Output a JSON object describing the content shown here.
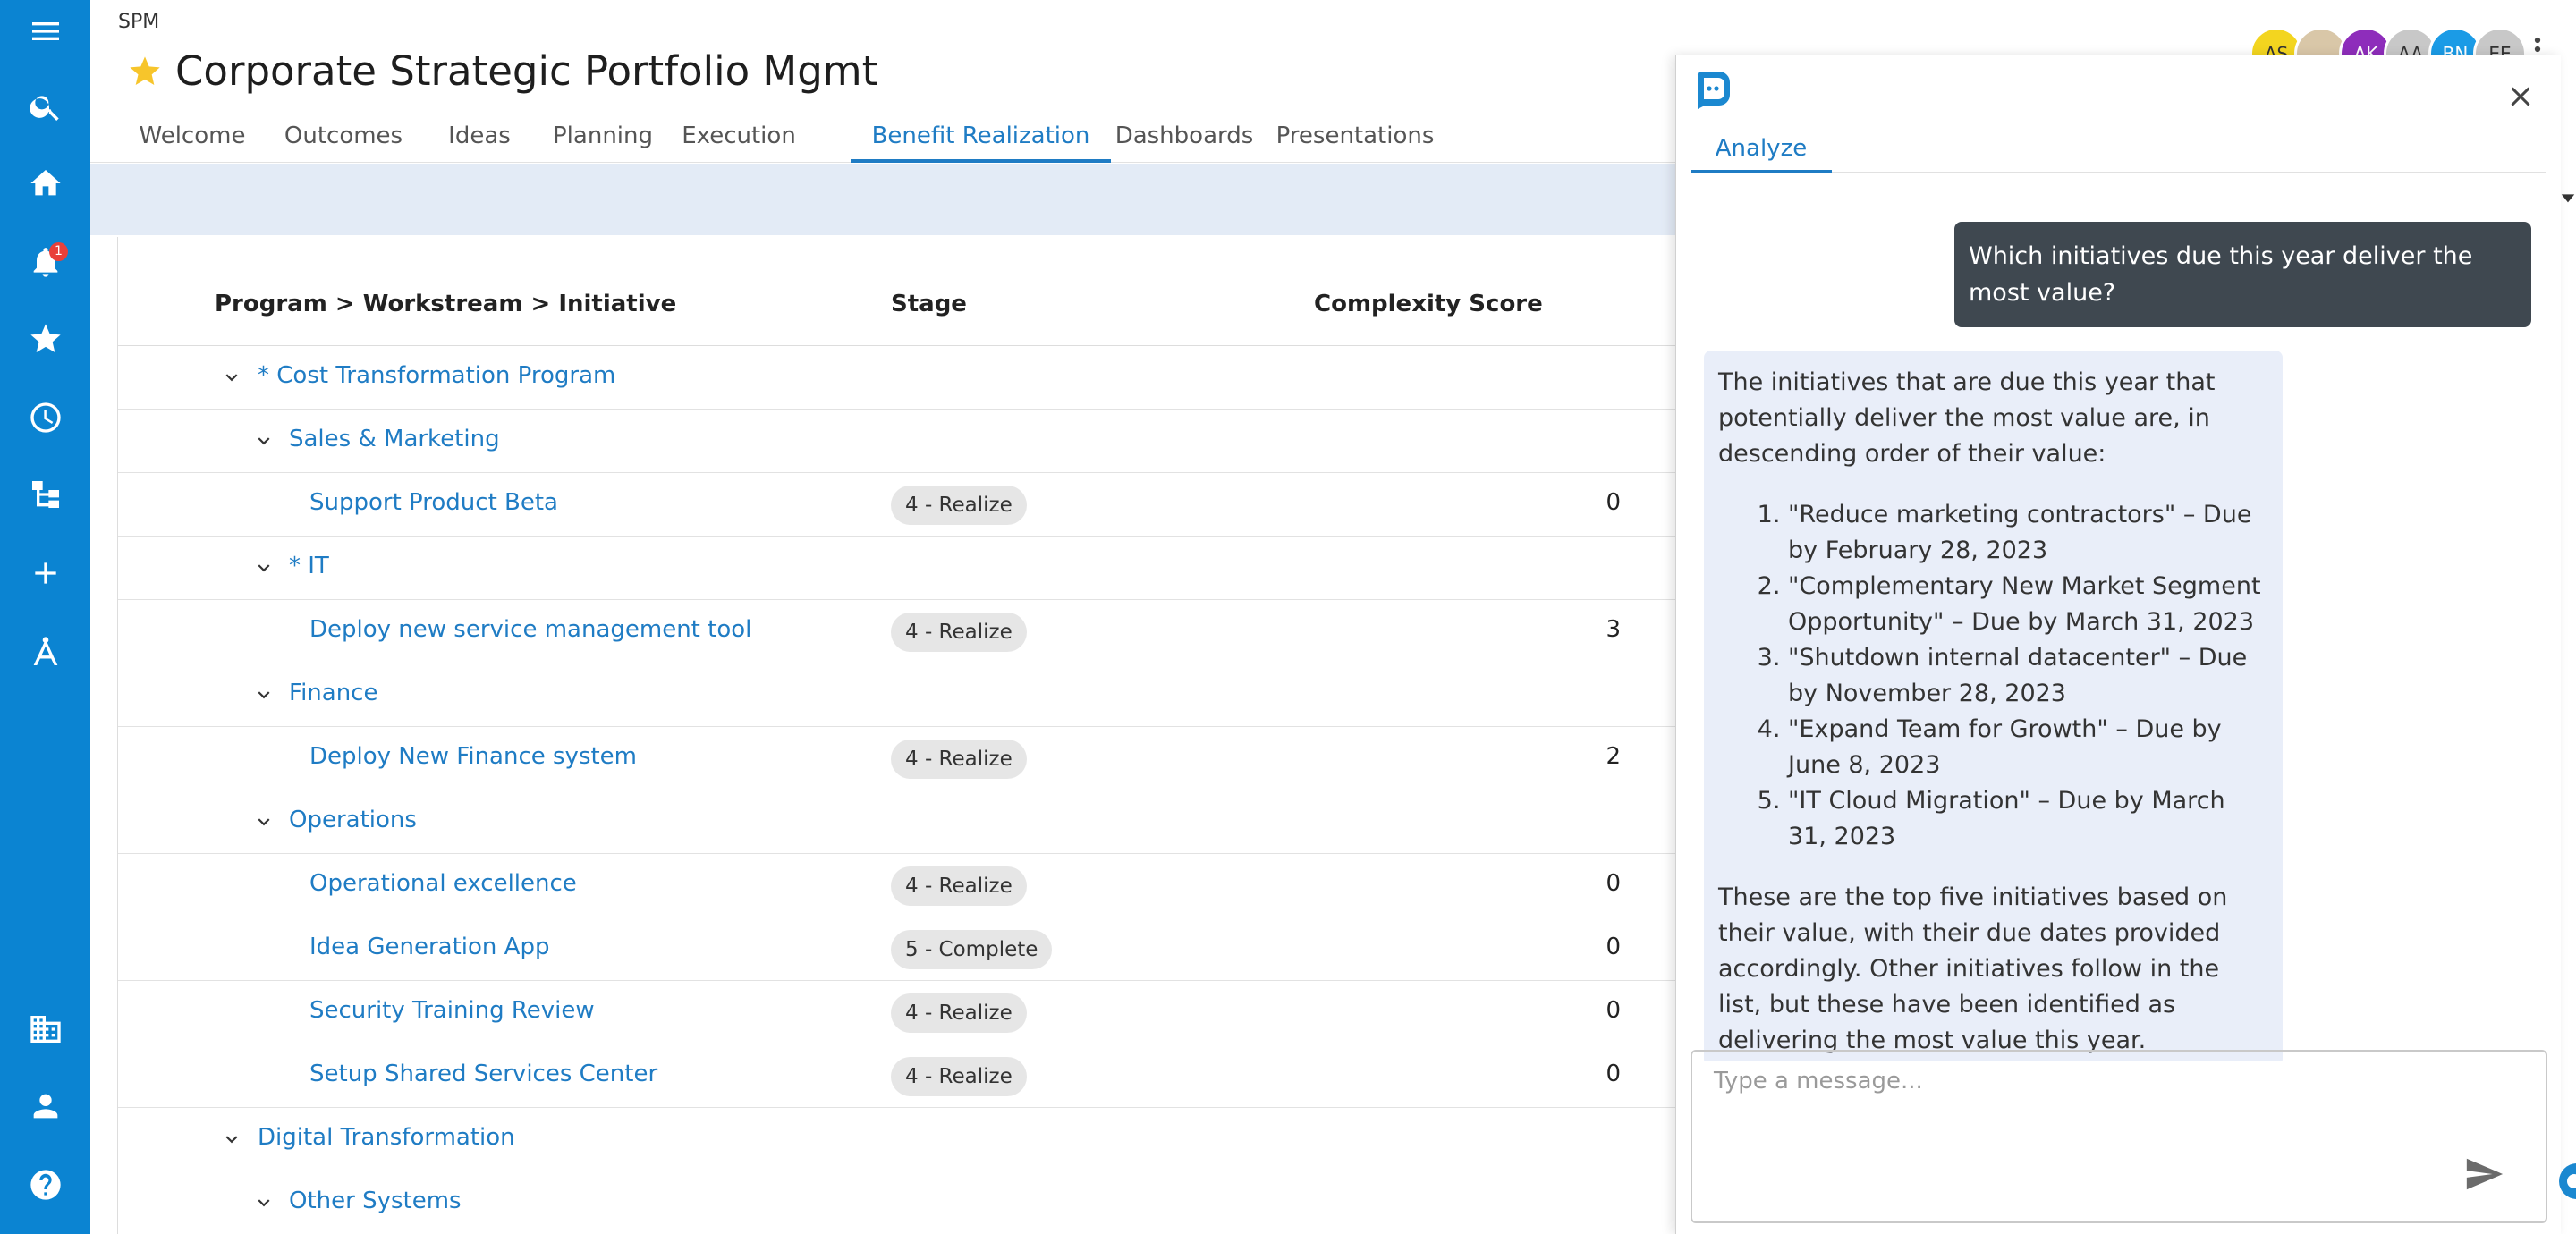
{
  "app": {
    "label": "SPM",
    "title": "Corporate Strategic Portfolio Mgmt"
  },
  "nav": {
    "notification_count": "1",
    "items": [
      "menu-icon",
      "search-icon",
      "home-icon",
      "bell-icon",
      "star-icon",
      "clock-icon",
      "hierarchy-icon",
      "plus-icon",
      "compass-icon",
      "building-icon",
      "user-icon",
      "help-icon"
    ]
  },
  "tabs": [
    "Welcome",
    "Outcomes",
    "Ideas",
    "Planning",
    "Execution",
    "Benefit Realization",
    "Dashboards",
    "Presentations"
  ],
  "active_tab": "Benefit Realization",
  "avatars": [
    {
      "initials": "AS",
      "color": "#f3d51f"
    },
    {
      "initials": "",
      "color": "#d9c7a8"
    },
    {
      "initials": "AK",
      "color": "#8e2dbb"
    },
    {
      "initials": "AA",
      "color": "#c8c8c8"
    },
    {
      "initials": "BN",
      "color": "#1b9be6"
    },
    {
      "initials": "EE",
      "color": "#c8c8c8"
    }
  ],
  "grid": {
    "headers": {
      "name": "Program > Workstream > Initiative",
      "stage": "Stage",
      "score": "Complexity Score"
    },
    "rows": [
      {
        "level": 0,
        "name": "* Cost Transformation Program",
        "stage": "",
        "score": ""
      },
      {
        "level": 1,
        "name": "Sales & Marketing",
        "stage": "",
        "score": ""
      },
      {
        "level": 2,
        "name": "Support Product Beta",
        "stage": "4 - Realize",
        "score": "0"
      },
      {
        "level": 1,
        "name": "* IT",
        "stage": "",
        "score": ""
      },
      {
        "level": 2,
        "name": "Deploy new service management tool",
        "stage": "4 - Realize",
        "score": "3"
      },
      {
        "level": 1,
        "name": "Finance",
        "stage": "",
        "score": ""
      },
      {
        "level": 2,
        "name": "Deploy New Finance system",
        "stage": "4 - Realize",
        "score": "2"
      },
      {
        "level": 1,
        "name": "Operations",
        "stage": "",
        "score": ""
      },
      {
        "level": 2,
        "name": "Operational excellence",
        "stage": "4 - Realize",
        "score": "0"
      },
      {
        "level": 2,
        "name": "Idea Generation App",
        "stage": "5 - Complete",
        "score": "0"
      },
      {
        "level": 2,
        "name": "Security Training Review",
        "stage": "4 - Realize",
        "score": "0"
      },
      {
        "level": 2,
        "name": "Setup Shared Services Center",
        "stage": "4 - Realize",
        "score": "0"
      },
      {
        "level": 0,
        "name": "Digital Transformation",
        "stage": "",
        "score": ""
      },
      {
        "level": 1,
        "name": "Other Systems",
        "stage": "",
        "score": ""
      }
    ]
  },
  "chat": {
    "tab": "Analyze",
    "user_message": "Which initiatives due this year deliver the most value?",
    "bot_intro": "The initiatives that are due this year that potentially deliver the most value are, in descending order of their value:",
    "bot_list": [
      "\"Reduce marketing contractors\" – Due by February 28, 2023",
      "\"Complementary New Market Segment Opportunity\" – Due by March 31, 2023",
      "\"Shutdown internal datacenter\" – Due by November 28, 2023",
      "\"Expand Team for Growth\" – Due by June 8, 2023",
      "\"IT Cloud Migration\" – Due by March 31, 2023"
    ],
    "bot_outro": "These are the top five initiatives based on their value, with their due dates provided accordingly. Other initiatives follow in the list, but these have been identified as delivering the most value this year.",
    "input_placeholder": "Type a message..."
  },
  "colors": {
    "nav": "#0b84d2",
    "accent": "#1f7cc4",
    "chat_user_bubble": "#3f4850",
    "chat_bot_bubble": "#e9eef9",
    "filter_strip": "#e3ebf6"
  }
}
